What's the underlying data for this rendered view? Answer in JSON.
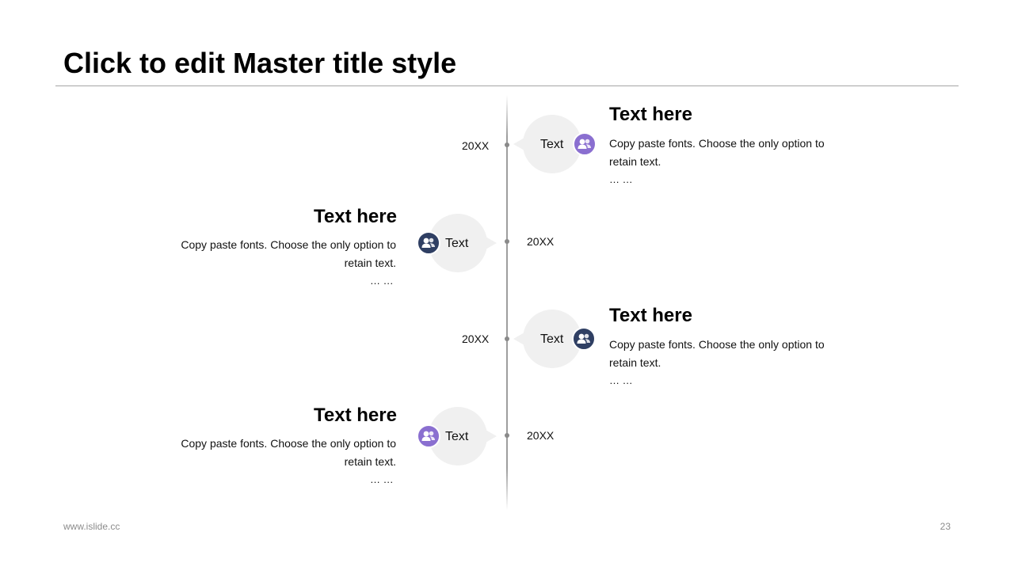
{
  "title": "Click to edit Master title style",
  "colors": {
    "purple": "#8a6fd0",
    "navy": "#2f3f63",
    "bubble": "#f0f0f0",
    "axis": "#9e9e9e"
  },
  "timeline": [
    {
      "year": "20XX",
      "bubble_label": "Text",
      "icon": "users-icon",
      "icon_color": "purple",
      "heading": "Text here",
      "body": "Copy paste fonts. Choose the only option to retain text.",
      "ellipsis": "… …"
    },
    {
      "year": "20XX",
      "bubble_label": "Text",
      "icon": "users-icon",
      "icon_color": "navy",
      "heading": "Text here",
      "body": "Copy paste fonts. Choose the only option to retain text.",
      "ellipsis": "… …"
    },
    {
      "year": "20XX",
      "bubble_label": "Text",
      "icon": "users-icon",
      "icon_color": "navy",
      "heading": "Text here",
      "body": "Copy paste fonts. Choose the only option to retain text.",
      "ellipsis": "… …"
    },
    {
      "year": "20XX",
      "bubble_label": "Text",
      "icon": "users-icon",
      "icon_color": "purple",
      "heading": "Text here",
      "body": "Copy paste fonts. Choose the only option to retain text.",
      "ellipsis": "… …"
    }
  ],
  "footer": {
    "url": "www.islide.cc",
    "page_number": "23"
  }
}
